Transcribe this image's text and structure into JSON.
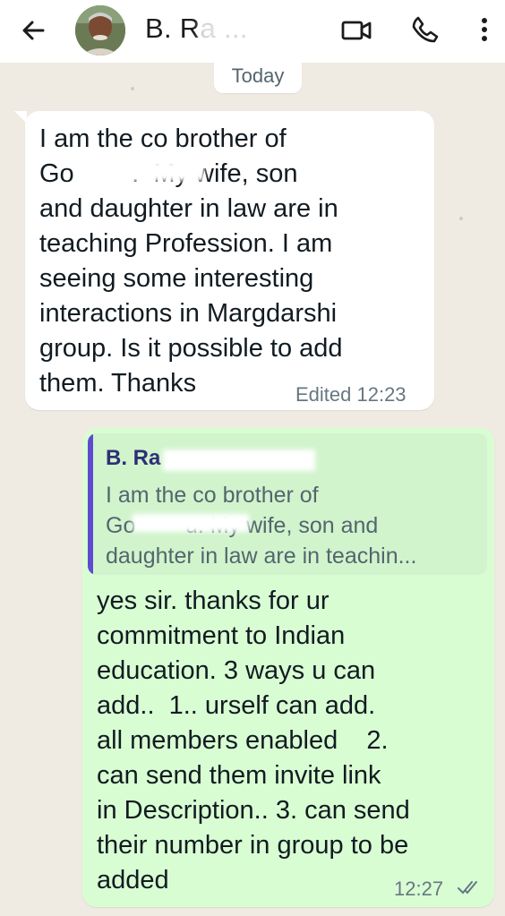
{
  "header": {
    "contact_name": "B. Ra ...",
    "icons": [
      "back-arrow-icon",
      "video-call-icon",
      "voice-call-icon",
      "more-vert-icon"
    ]
  },
  "date_chip": "Today",
  "messages": [
    {
      "direction": "incoming",
      "text": "I am the co brother of\nGo        .  My wife, son\nand daughter in law are in\nteaching Profession. I am\nseeing some interesting\ninteractions in Margdarshi\ngroup. Is it possible to add\nthem. Thanks",
      "meta": "Edited 12:23"
    },
    {
      "direction": "outgoing",
      "quote": {
        "author": "B. Ra",
        "text": "I am the co brother of\nGo        u. My wife, son and\ndaughter in law are in teachin..."
      },
      "text": "yes sir. thanks for ur\ncommitment to Indian\neducation. 3 ways u can\nadd..  1.. urself can add.\nall members enabled    2.\ncan send them invite link\nin Description.. 3. can send\ntheir number in group to be\nadded",
      "meta": "12:27",
      "status": "read-double-tick-icon"
    }
  ],
  "colors": {
    "background": "#efeae2",
    "incoming_bubble": "#ffffff",
    "outgoing_bubble": "#d9fdd3",
    "quote_bar": "#5e4bd1"
  }
}
